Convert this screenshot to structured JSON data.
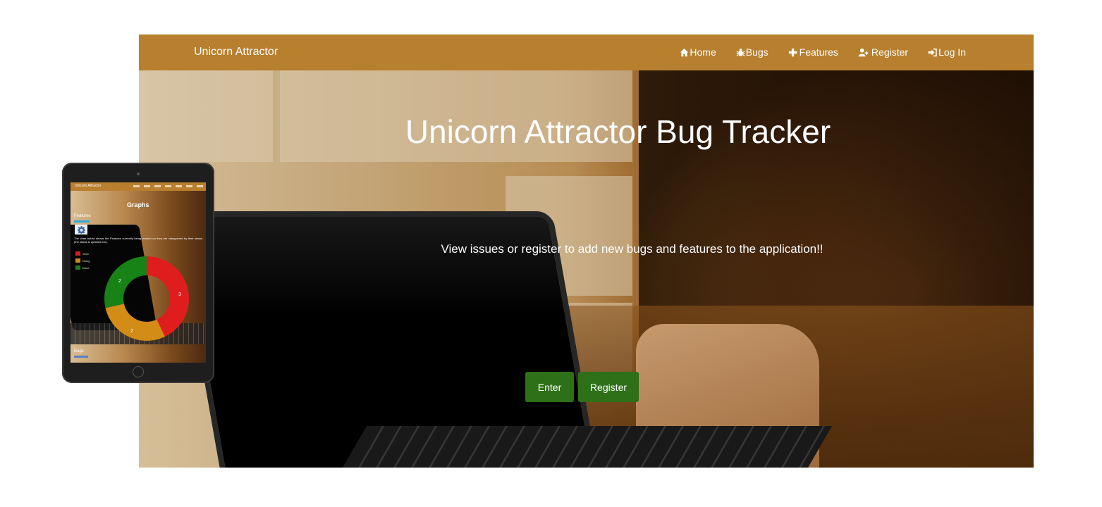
{
  "navbar": {
    "brand": "Unicorn Attractor",
    "items": [
      {
        "label": "Home",
        "icon": "home-icon"
      },
      {
        "label": "Bugs",
        "icon": "bug-icon"
      },
      {
        "label": "Features",
        "icon": "plus-icon"
      },
      {
        "label": "Register",
        "icon": "user-plus-icon"
      },
      {
        "label": "Log In",
        "icon": "sign-in-icon"
      }
    ],
    "color": "#b87f2e"
  },
  "hero": {
    "title": "Unicorn Attractor Bug Tracker",
    "subtitle": "View issues or register to add new bugs and features to the application!!",
    "buttons": {
      "enter": "Enter",
      "register": "Register"
    },
    "button_color": "#2d7018"
  },
  "tablet": {
    "brand": "Unicorn Attractor",
    "heading": "Graphs",
    "features_label": "Features",
    "description": "The chart below shows the Features currently being worked on they are categorized by their status (the status is updated live).",
    "legend": [
      {
        "label": "Todo",
        "color": "#d21e1e"
      },
      {
        "label": "Doing",
        "color": "#c98a1e"
      },
      {
        "label": "Done",
        "color": "#1e7a1e"
      }
    ],
    "chart_values": {
      "todo": 3,
      "doing": 2,
      "done": 2
    },
    "donut_labels": {
      "todo": "3",
      "doing": "2",
      "done": "2"
    },
    "bugs_label": "Bugs"
  }
}
